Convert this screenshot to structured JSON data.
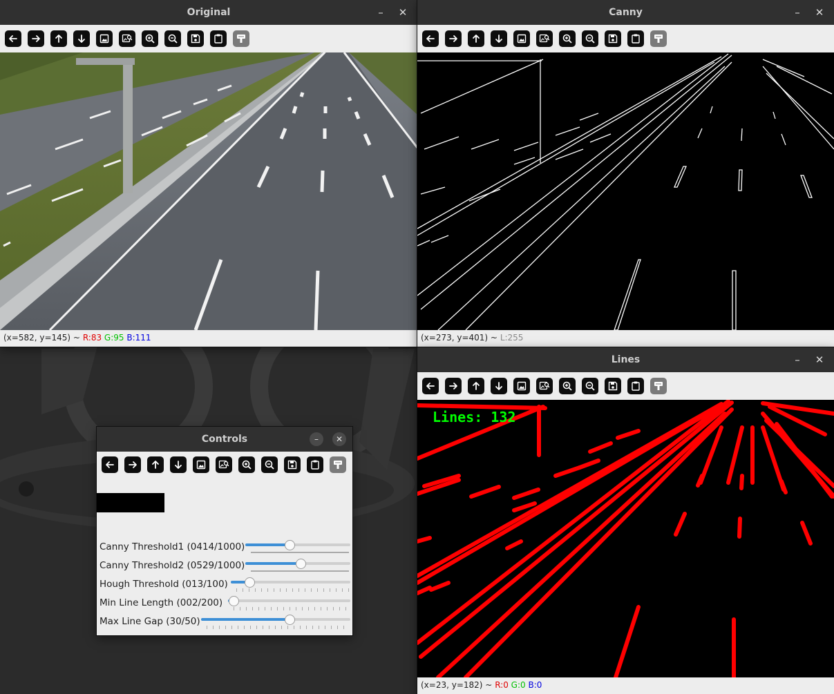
{
  "windows": {
    "original": {
      "title": "Original",
      "status": {
        "coords": "(x=582, y=145) ~",
        "r": "R:83",
        "g": "G:95",
        "b": "B:111"
      }
    },
    "canny": {
      "title": "Canny",
      "status": {
        "coords": "(x=273, y=401) ~",
        "l": "L:255"
      }
    },
    "lines": {
      "title": "Lines",
      "overlay_text": "Lines: 132",
      "status": {
        "coords": "(x=23, y=182) ~",
        "r": "R:0",
        "g": "G:0",
        "b": "B:0"
      }
    },
    "controls": {
      "title": "Controls",
      "trackbars": [
        {
          "label": "Canny Threshold1 (0414/1000)",
          "value": 414,
          "max": 1000
        },
        {
          "label": "Canny Threshold2 (0529/1000)",
          "value": 529,
          "max": 1000
        },
        {
          "label": "Hough Threshold (013/100)",
          "value": 13,
          "max": 100
        },
        {
          "label": "Min Line Length (002/200)",
          "value": 2,
          "max": 200
        },
        {
          "label": "Max Line Gap (30/50)",
          "value": 30,
          "max": 50
        }
      ]
    }
  },
  "toolbar_buttons": [
    "arrow-left-icon",
    "arrow-right-icon",
    "arrow-up-icon",
    "arrow-down-icon",
    "image-icon",
    "image-zoom-icon",
    "zoom-in-icon",
    "zoom-out-icon",
    "save-icon",
    "clipboard-icon",
    "properties-icon"
  ],
  "colors": {
    "titlebar": "#303030",
    "window_bg": "#ededed",
    "slider_fill": "#3d8fd6",
    "line_red": "#ff0000",
    "overlay_green": "#00ff00"
  }
}
